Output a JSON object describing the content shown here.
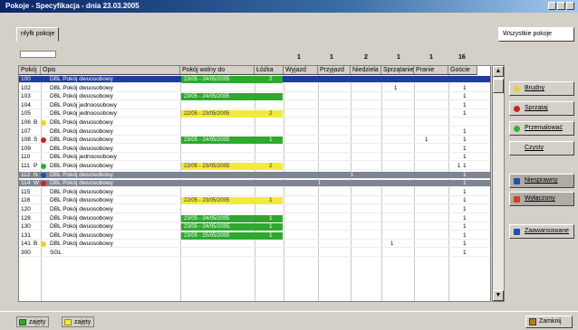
{
  "window": {
    "title": "Pokoje - Specyfikacja - dnia 23.03.2005"
  },
  "tabs": {
    "left": "nfyfk pokoje",
    "right": "Wszystkie pokoje"
  },
  "top_numbers": [
    "1",
    "1",
    "2",
    "1",
    "1",
    "16"
  ],
  "columns": [
    "Pokój",
    "Opis",
    "Pokój wolny do",
    "Łóżka",
    "Wyjazd",
    "Przyjazd",
    "Niedziela",
    "Sprzątanie",
    "Pranie",
    "Goście"
  ],
  "rows": [
    {
      "room": "100",
      "desc": "DBL Pokój dwuosobowy",
      "period": "23/05 - 24/05/2005",
      "beds": "2",
      "color": "green",
      "mark": "",
      "icon": "",
      "sel": true,
      "count": ""
    },
    {
      "room": "102",
      "desc": "DBL Pokój dwuosobowy",
      "period": "",
      "beds": "",
      "color": "",
      "mark": "",
      "icon": "",
      "sel": false,
      "count": "1"
    },
    {
      "room": "103",
      "desc": "DBL Pokój dwuosobowy",
      "period": "23/05 - 24/05/2005",
      "beds": "",
      "color": "green",
      "mark": "",
      "icon": "",
      "sel": false,
      "count": "1"
    },
    {
      "room": "104",
      "desc": "DBL Pokój jednoosobowy",
      "period": "",
      "beds": "",
      "color": "",
      "mark": "",
      "icon": "",
      "sel": false,
      "count": "1"
    },
    {
      "room": "105",
      "desc": "DBL Pokój jednoosobowy",
      "period": "22/05 - 23/05/2005",
      "beds": "2",
      "color": "yellow",
      "mark": "",
      "icon": "",
      "sel": false,
      "count": "1"
    },
    {
      "room": "106",
      "desc": "DBL Pokój dwuosobowy",
      "period": "",
      "beds": "",
      "color": "",
      "mark": "B",
      "icon": "yellow",
      "sel": false,
      "count": ""
    },
    {
      "room": "107",
      "desc": "DBL Pokój dwuosobowy",
      "period": "",
      "beds": "",
      "color": "",
      "mark": "",
      "icon": "",
      "sel": false,
      "count": "1"
    },
    {
      "room": "108",
      "desc": "DBL Pokój dwuosobowy",
      "period": "23/05 - 24/05/2005",
      "beds": "1",
      "color": "green",
      "mark": "S",
      "icon": "red",
      "sel": false,
      "count": "1"
    },
    {
      "room": "109",
      "desc": "DBL Pokój dwuosobowy",
      "period": "",
      "beds": "",
      "color": "",
      "mark": "",
      "icon": "",
      "sel": false,
      "count": "1"
    },
    {
      "room": "110",
      "desc": "DBL Pokój jednoosobowy",
      "period": "",
      "beds": "",
      "color": "",
      "mark": "",
      "icon": "",
      "sel": false,
      "count": "1"
    },
    {
      "room": "111",
      "desc": "DBL Pokój dwuosobowy",
      "period": "22/05 - 23/05/2005",
      "beds": "2",
      "color": "yellow",
      "mark": "P",
      "icon": "green",
      "sel": false,
      "count": "1"
    },
    {
      "room": "112",
      "desc": "DBL Pokój dwuosobowy",
      "period": "",
      "beds": "",
      "color": "",
      "mark": "N",
      "icon": "blue",
      "sel": false,
      "count": "1",
      "gray": true
    },
    {
      "room": "114",
      "desc": "DBL Pokój dwuosobowy",
      "period": "",
      "beds": "",
      "color": "",
      "mark": "W",
      "icon": "red",
      "sel": false,
      "count": "1",
      "gray": true
    },
    {
      "room": "115",
      "desc": "DBL Pokój dwuosobowy",
      "period": "",
      "beds": "",
      "color": "",
      "mark": "",
      "icon": "",
      "sel": false,
      "count": "1"
    },
    {
      "room": "116",
      "desc": "DBL Pokój dwuosobowy",
      "period": "22/05 - 23/05/2005",
      "beds": "1",
      "color": "yellow",
      "mark": "",
      "icon": "",
      "sel": false,
      "count": "1"
    },
    {
      "room": "120",
      "desc": "DBL Pokój dwuosobowy",
      "period": "",
      "beds": "",
      "color": "",
      "mark": "",
      "icon": "",
      "sel": false,
      "count": "1"
    },
    {
      "room": "128",
      "desc": "DBL Pokój dwuosobowy",
      "period": "23/05 - 24/05/2005",
      "beds": "1",
      "color": "green",
      "mark": "",
      "icon": "",
      "sel": false,
      "count": "1"
    },
    {
      "room": "130",
      "desc": "DBL Pokój dwuosobowy",
      "period": "23/05 - 24/05/2005",
      "beds": "1",
      "color": "green",
      "mark": "",
      "icon": "",
      "sel": false,
      "count": "1"
    },
    {
      "room": "131",
      "desc": "DBL Pokój dwuosobowy",
      "period": "23/05 - 25/05/2005",
      "beds": "1",
      "color": "green",
      "mark": "",
      "icon": "",
      "sel": false,
      "count": "1"
    },
    {
      "room": "141",
      "desc": "DBL Pokój dwuosobowy",
      "period": "",
      "beds": "",
      "color": "",
      "mark": "B",
      "icon": "yellow",
      "sel": false,
      "count": "1"
    },
    {
      "room": "300",
      "desc": "SGL",
      "period": "",
      "beds": "",
      "color": "",
      "mark": "",
      "icon": "",
      "sel": false,
      "count": "1"
    }
  ],
  "side_buttons": [
    {
      "label": "Brudny",
      "icon_color": "#e8d030"
    },
    {
      "label": "Sprzątaj",
      "icon_color": "#d02020"
    },
    {
      "label": "Przemalować",
      "icon_color": "#30b030"
    },
    {
      "label": "Czysty",
      "icon_color": ""
    },
    {
      "label": "Niesprawny",
      "icon_color": "#2050b0"
    },
    {
      "label": "Wyłączony",
      "icon_color": "#d04020"
    },
    {
      "label": "Zaawansowane",
      "icon_color": "#2050b0"
    }
  ],
  "legend": [
    {
      "label": "zajęty",
      "color": "#2ea82e"
    },
    {
      "label": "zajęty",
      "color": "#f2ea3a"
    }
  ],
  "close_label": "Zamknij",
  "colors": {
    "green": "#2ea82e",
    "yellow": "#f2ea3a",
    "red": "#d02020",
    "blue": "#2050b0",
    "selected": "#1f3d9c"
  }
}
